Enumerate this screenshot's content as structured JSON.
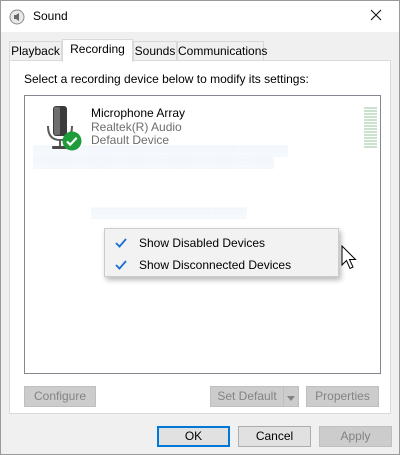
{
  "window": {
    "title": "Sound",
    "icon": "speaker-app-icon",
    "close_icon": "close-icon"
  },
  "tabs": [
    {
      "label": "Playback",
      "active": false
    },
    {
      "label": "Recording",
      "active": true
    },
    {
      "label": "Sounds",
      "active": false
    },
    {
      "label": "Communications",
      "active": false
    }
  ],
  "recording": {
    "instruction": "Select a recording device below to modify its settings:",
    "devices": [
      {
        "name": "Microphone Array",
        "driver": "Realtek(R) Audio",
        "status": "Default Device",
        "icon": "microphone-icon",
        "badge": "default-check-icon",
        "level_percent": 0
      }
    ]
  },
  "context_menu": {
    "items": [
      {
        "label": "Show Disabled Devices",
        "checked": true
      },
      {
        "label": "Show Disconnected Devices",
        "checked": true
      }
    ]
  },
  "buttons": {
    "configure": "Configure",
    "set_default": "Set Default",
    "properties": "Properties",
    "ok": "OK",
    "cancel": "Cancel",
    "apply": "Apply"
  },
  "colors": {
    "accent": "#0078d7",
    "check_badge": "#1e9c3a",
    "menu_check": "#1a6fd4"
  }
}
